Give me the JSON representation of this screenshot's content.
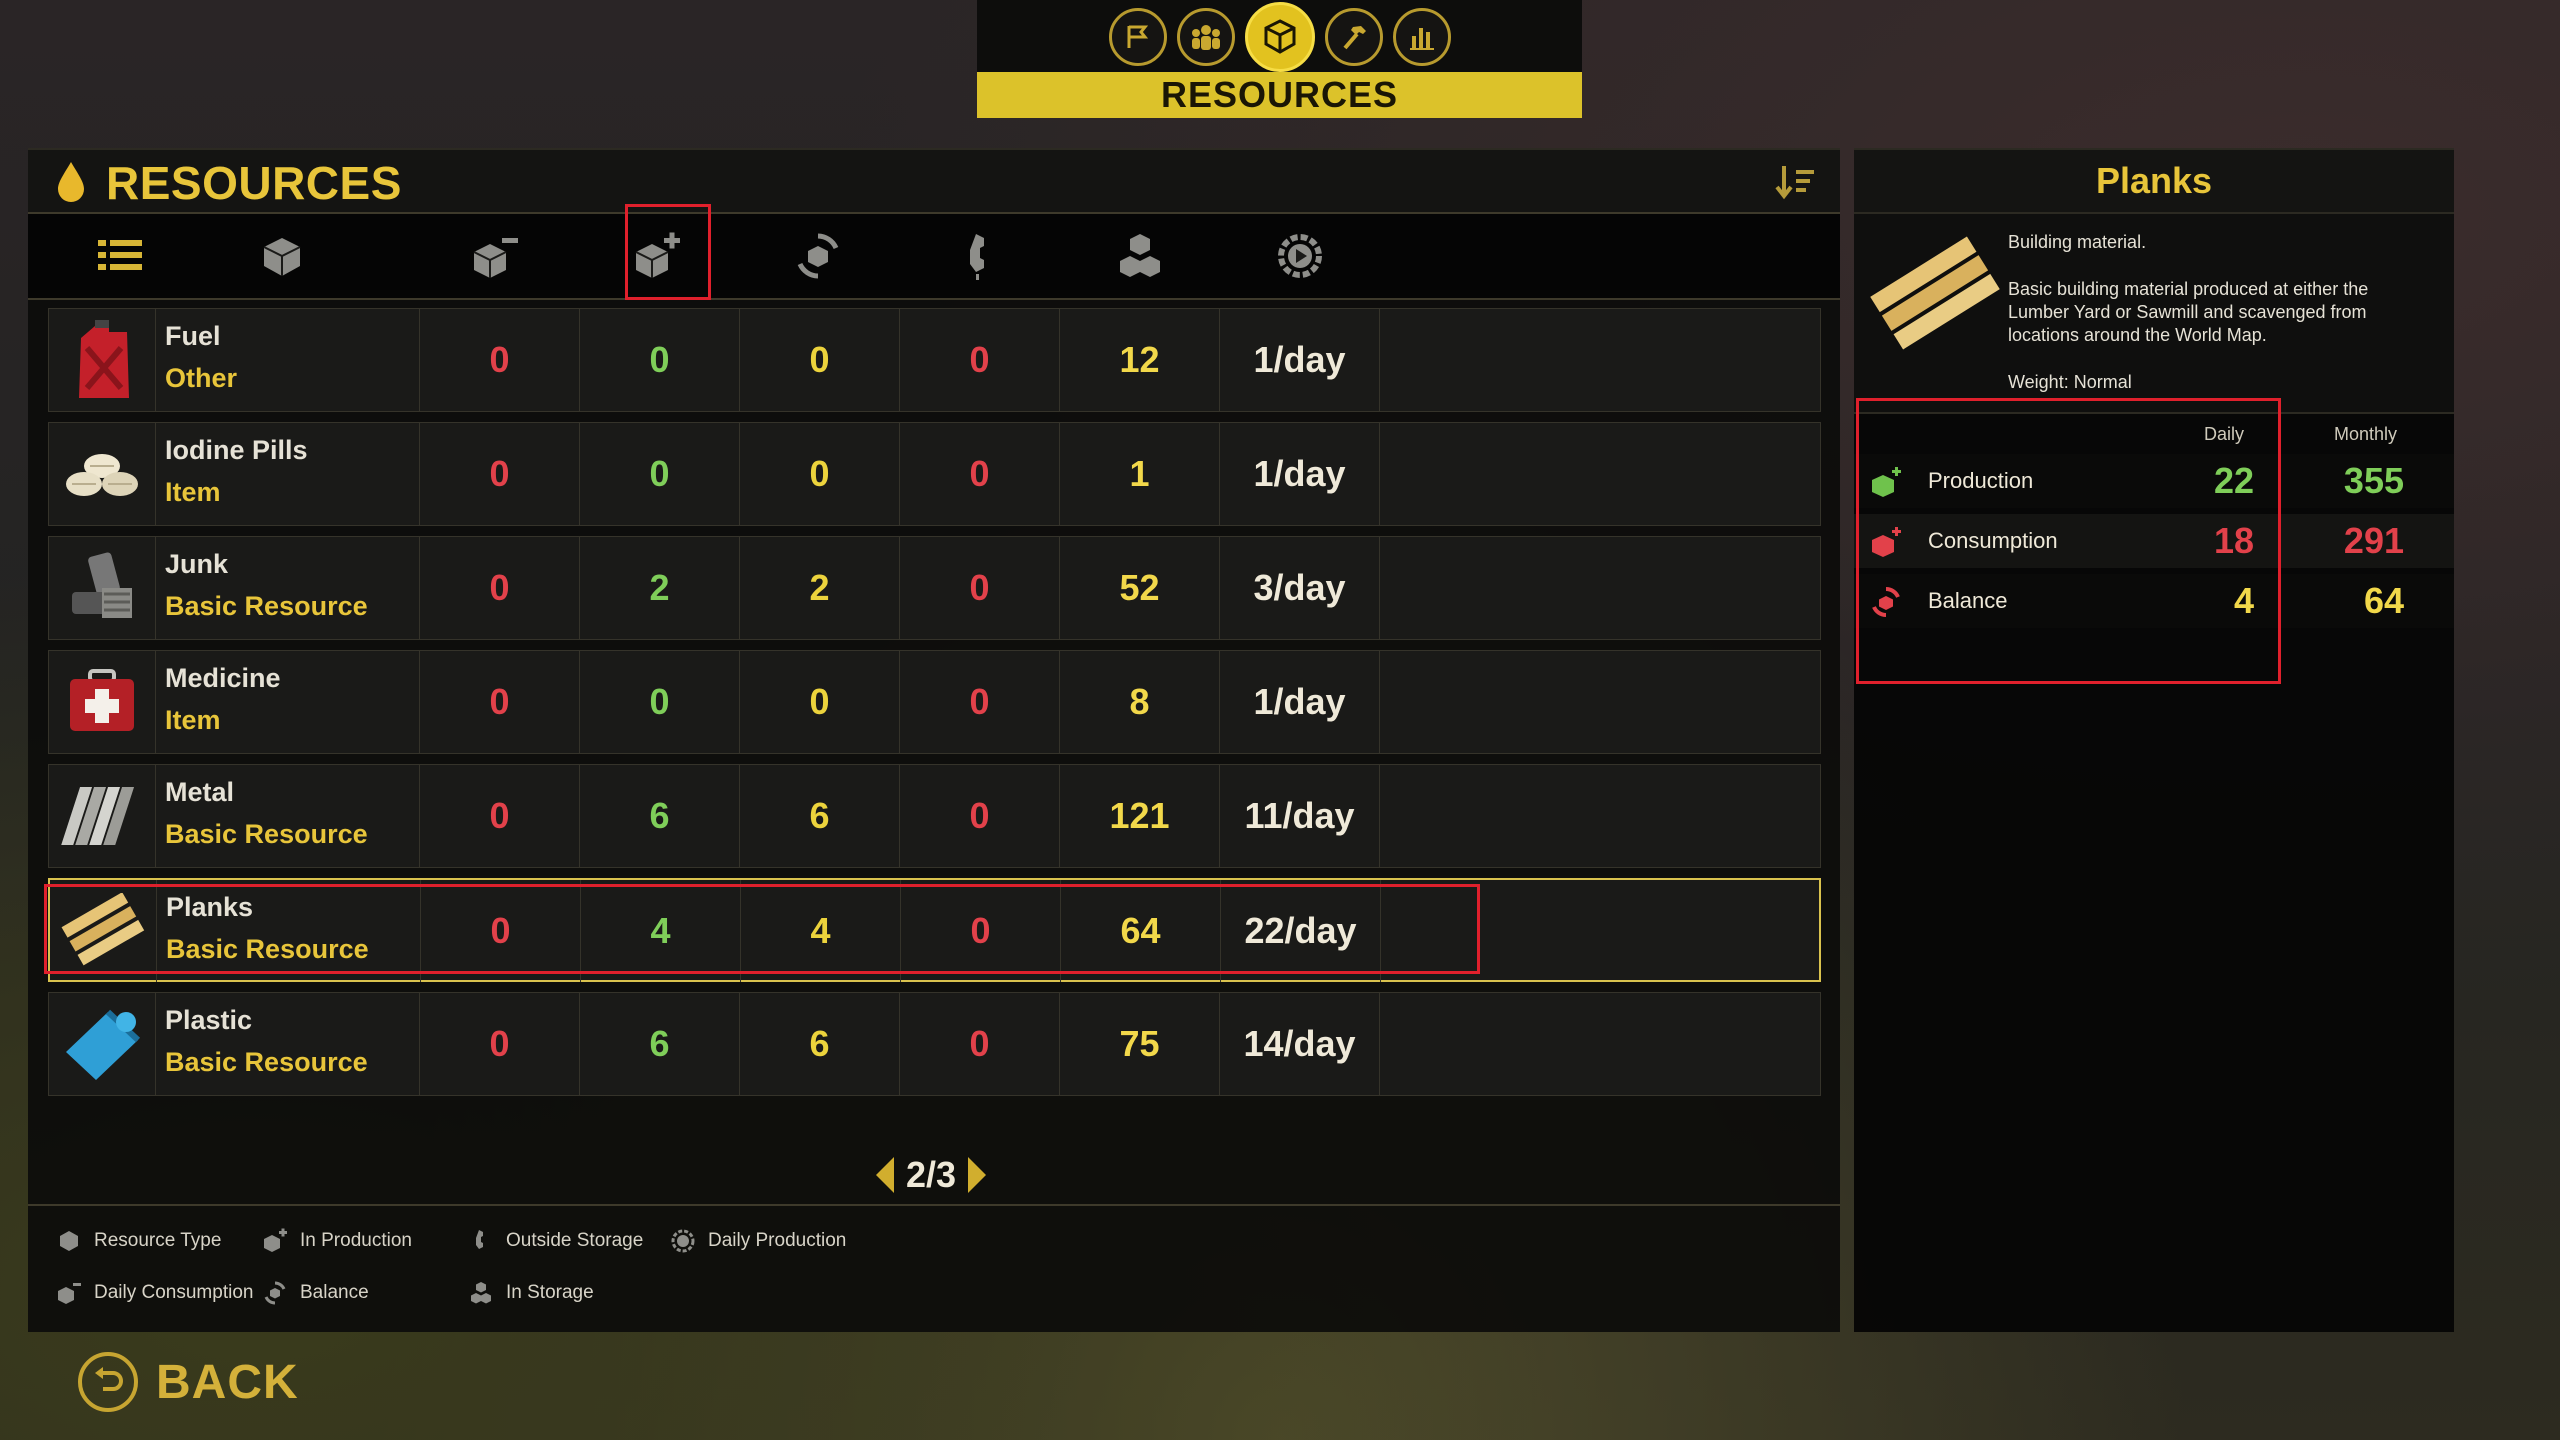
{
  "topnav": {
    "icons": [
      "flag-icon",
      "people-icon",
      "resources-icon",
      "hammer-icon",
      "chart-icon"
    ],
    "active": "resources-icon",
    "banner": "RESOURCES"
  },
  "panel": {
    "title": "RESOURCES",
    "columns": [
      "list-icon",
      "resource-type-icon",
      "daily-consumption-icon",
      "in-production-icon",
      "balance-icon",
      "outside-storage-icon",
      "in-storage-icon",
      "daily-production-icon"
    ],
    "rows": [
      {
        "name": "Fuel",
        "type": "Other",
        "values": [
          "0",
          "0",
          "0",
          "0",
          "12",
          "1/day"
        ]
      },
      {
        "name": "Iodine Pills",
        "type": "Item",
        "values": [
          "0",
          "0",
          "0",
          "0",
          "1",
          "1/day"
        ]
      },
      {
        "name": "Junk",
        "type": "Basic Resource",
        "values": [
          "0",
          "2",
          "2",
          "0",
          "52",
          "3/day"
        ]
      },
      {
        "name": "Medicine",
        "type": "Item",
        "values": [
          "0",
          "0",
          "0",
          "0",
          "8",
          "1/day"
        ]
      },
      {
        "name": "Metal",
        "type": "Basic Resource",
        "values": [
          "0",
          "6",
          "6",
          "0",
          "121",
          "11/day"
        ]
      },
      {
        "name": "Planks",
        "type": "Basic Resource",
        "values": [
          "0",
          "4",
          "4",
          "0",
          "64",
          "22/day"
        ]
      },
      {
        "name": "Plastic",
        "type": "Basic Resource",
        "values": [
          "0",
          "6",
          "6",
          "0",
          "75",
          "14/day"
        ]
      }
    ],
    "pager": "2/3",
    "legend": {
      "resource_type": "Resource Type",
      "in_production": "In Production",
      "outside_storage": "Outside Storage",
      "daily_production": "Daily Production",
      "daily_consumption": "Daily Consumption",
      "balance": "Balance",
      "in_storage": "In Storage"
    }
  },
  "detail": {
    "title": "Planks",
    "desc_short": "Building material.",
    "desc_long": "Basic building material produced at either the Lumber Yard or Sawmill and scavenged from locations around the World Map.",
    "weight": "Weight: Normal",
    "head_daily": "Daily",
    "head_monthly": "Monthly",
    "stats": [
      {
        "label": "Production",
        "daily": "22",
        "monthly": "355",
        "color": "#7fce59"
      },
      {
        "label": "Consumption",
        "daily": "18",
        "monthly": "291",
        "color": "#e2414a"
      },
      {
        "label": "Balance",
        "daily": "4",
        "monthly": "64",
        "color": "#f2d84a"
      }
    ]
  },
  "back_label": "BACK"
}
